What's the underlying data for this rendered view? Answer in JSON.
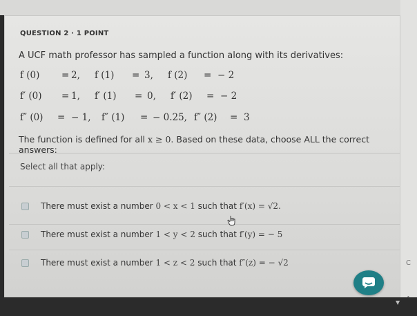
{
  "question": {
    "header": "QUESTION 2 · 1 POINT",
    "intro": "A UCF math professor has sampled a function along with its derivatives:",
    "values": [
      {
        "label": "f (0)",
        "eq": "=",
        "val": "2,"
      },
      {
        "label": "f (1)",
        "eq": "=",
        "val": "3,"
      },
      {
        "label": "f (2)",
        "eq": "=",
        "val": "− 2"
      }
    ],
    "first_derivs": [
      {
        "label": "f′ (0)",
        "eq": "=",
        "val": "1,"
      },
      {
        "label": "f′ (1)",
        "eq": "=",
        "val": "0,"
      },
      {
        "label": "f′ (2)",
        "eq": "=",
        "val": "− 2"
      }
    ],
    "second_derivs": [
      {
        "label": "f″ (0)",
        "eq": "=",
        "val": "− 1,"
      },
      {
        "label": "f″ (1)",
        "eq": "=",
        "val": "− 0.25,"
      },
      {
        "label": "f″ (2)",
        "eq": "=",
        "val": "3"
      }
    ],
    "domain_prefix": "The function is defined for all ",
    "domain_math": "x ≥ 0",
    "domain_suffix": ". Based on these data, choose ALL the correct answers:",
    "select_label": "Select all that apply:"
  },
  "options": [
    {
      "prefix": "There must exist a number ",
      "cond": "0 < x < 1",
      "mid": " such that ",
      "expr": "f′(x)  =  √2."
    },
    {
      "prefix": "There must exist a number ",
      "cond": "1 < y < 2",
      "mid": " such that ",
      "expr": "f′(y)  =  − 5"
    },
    {
      "prefix": "There must exist a number ",
      "cond": "1 < z < 2",
      "mid": " such that ",
      "expr": "f″(z)  =  − √2"
    }
  ],
  "side": {
    "top_char": "C",
    "bottom_char": "A"
  },
  "colors": {
    "chat_button": "#1f7f86",
    "card_bg": "#e2e2e0"
  },
  "icons": {
    "chat": "chat-bubble-icon",
    "cursor": "hand-cursor-icon"
  }
}
